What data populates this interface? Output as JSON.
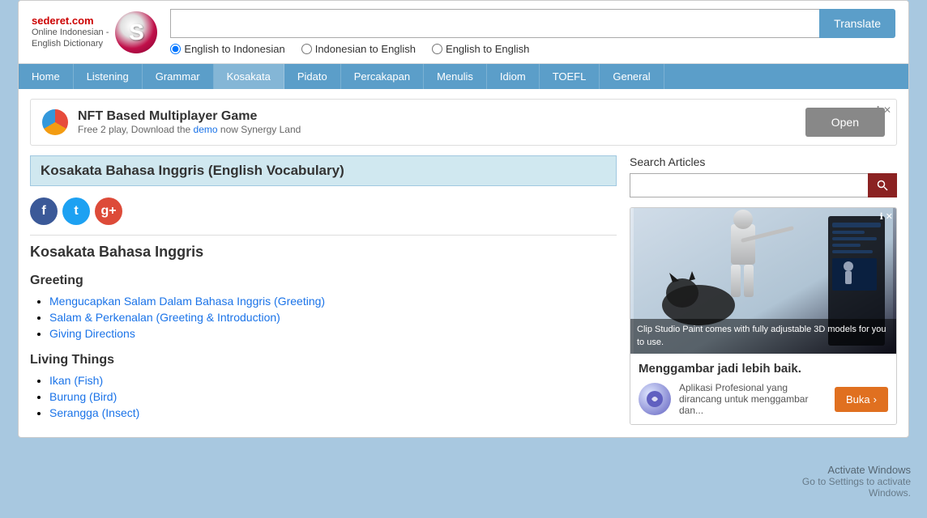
{
  "site": {
    "name": "sederet.com",
    "tagline": "Online Indonesian -\nEnglish Dictionary"
  },
  "header": {
    "search_placeholder": "",
    "translate_label": "Translate",
    "radio_options": [
      {
        "id": "eng_to_id",
        "label": "English to Indonesian",
        "checked": true
      },
      {
        "id": "id_to_eng",
        "label": "Indonesian to English",
        "checked": false
      },
      {
        "id": "eng_to_eng",
        "label": "English to English",
        "checked": false
      }
    ]
  },
  "nav": {
    "items": [
      {
        "label": "Home",
        "active": false
      },
      {
        "label": "Listening",
        "active": false
      },
      {
        "label": "Grammar",
        "active": false
      },
      {
        "label": "Kosakata",
        "active": true
      },
      {
        "label": "Pidato",
        "active": false
      },
      {
        "label": "Percakapan",
        "active": false
      },
      {
        "label": "Menulis",
        "active": false
      },
      {
        "label": "Idiom",
        "active": false
      },
      {
        "label": "TOEFL",
        "active": false
      },
      {
        "label": "General",
        "active": false
      }
    ]
  },
  "ad_banner": {
    "title": "NFT Based Multiplayer Game",
    "subtitle": "Free 2 play, Download the demo now Synergy Land",
    "open_label": "Open"
  },
  "page_title": "Kosakata Bahasa Inggris (English Vocabulary)",
  "social": {
    "facebook": "f",
    "twitter": "t",
    "googleplus": "g+"
  },
  "content": {
    "main_title": "Kosakata Bahasa Inggris",
    "categories": [
      {
        "title": "Greeting",
        "links": [
          "Mengucapkan Salam Dalam Bahasa Inggris (Greeting)",
          "Salam & Perkenalan (Greeting & Introduction)",
          "Giving Directions"
        ]
      },
      {
        "title": "Living Things",
        "links": [
          "Ikan (Fish)",
          "Burung (Bird)",
          "Serangga (Insect)"
        ]
      }
    ]
  },
  "sidebar": {
    "search_articles_label": "Search Articles",
    "search_placeholder": "",
    "search_btn_icon": "🔍",
    "ad": {
      "image_overlay_text": "Clip Studio Paint comes with\nfully adjustable 3D models for you to use.",
      "title": "Menggambar jadi lebih baik.",
      "desc": "Aplikasi Profesional yang dirancang untuk menggambar dan...",
      "buka_label": "Buka",
      "buka_arrow": "›"
    }
  },
  "watermark": {
    "line1": "Activate Windows",
    "line2": "Go to Settings to activate",
    "line3": "Windows."
  }
}
